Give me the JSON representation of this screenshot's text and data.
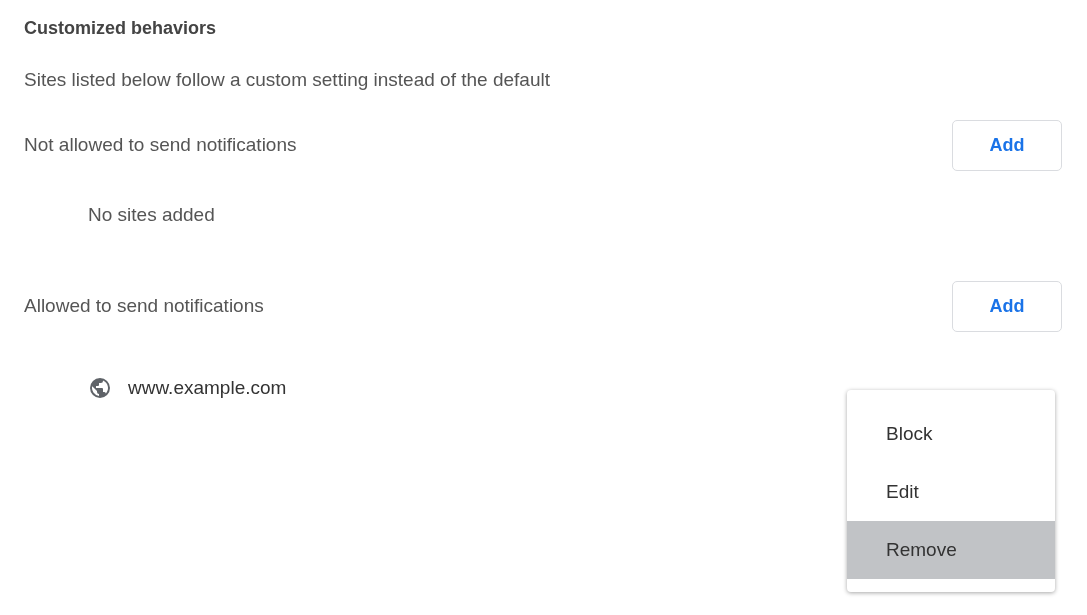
{
  "section": {
    "title": "Customized behaviors",
    "description": "Sites listed below follow a custom setting instead of the default"
  },
  "groups": [
    {
      "label": "Not allowed to send notifications",
      "add_button": "Add",
      "empty_text": "No sites added"
    },
    {
      "label": "Allowed to send notifications",
      "add_button": "Add",
      "sites": [
        {
          "url": "www.example.com"
        }
      ]
    }
  ],
  "menu": {
    "items": [
      {
        "label": "Block",
        "selected": false
      },
      {
        "label": "Edit",
        "selected": false
      },
      {
        "label": "Remove",
        "selected": true
      }
    ]
  }
}
